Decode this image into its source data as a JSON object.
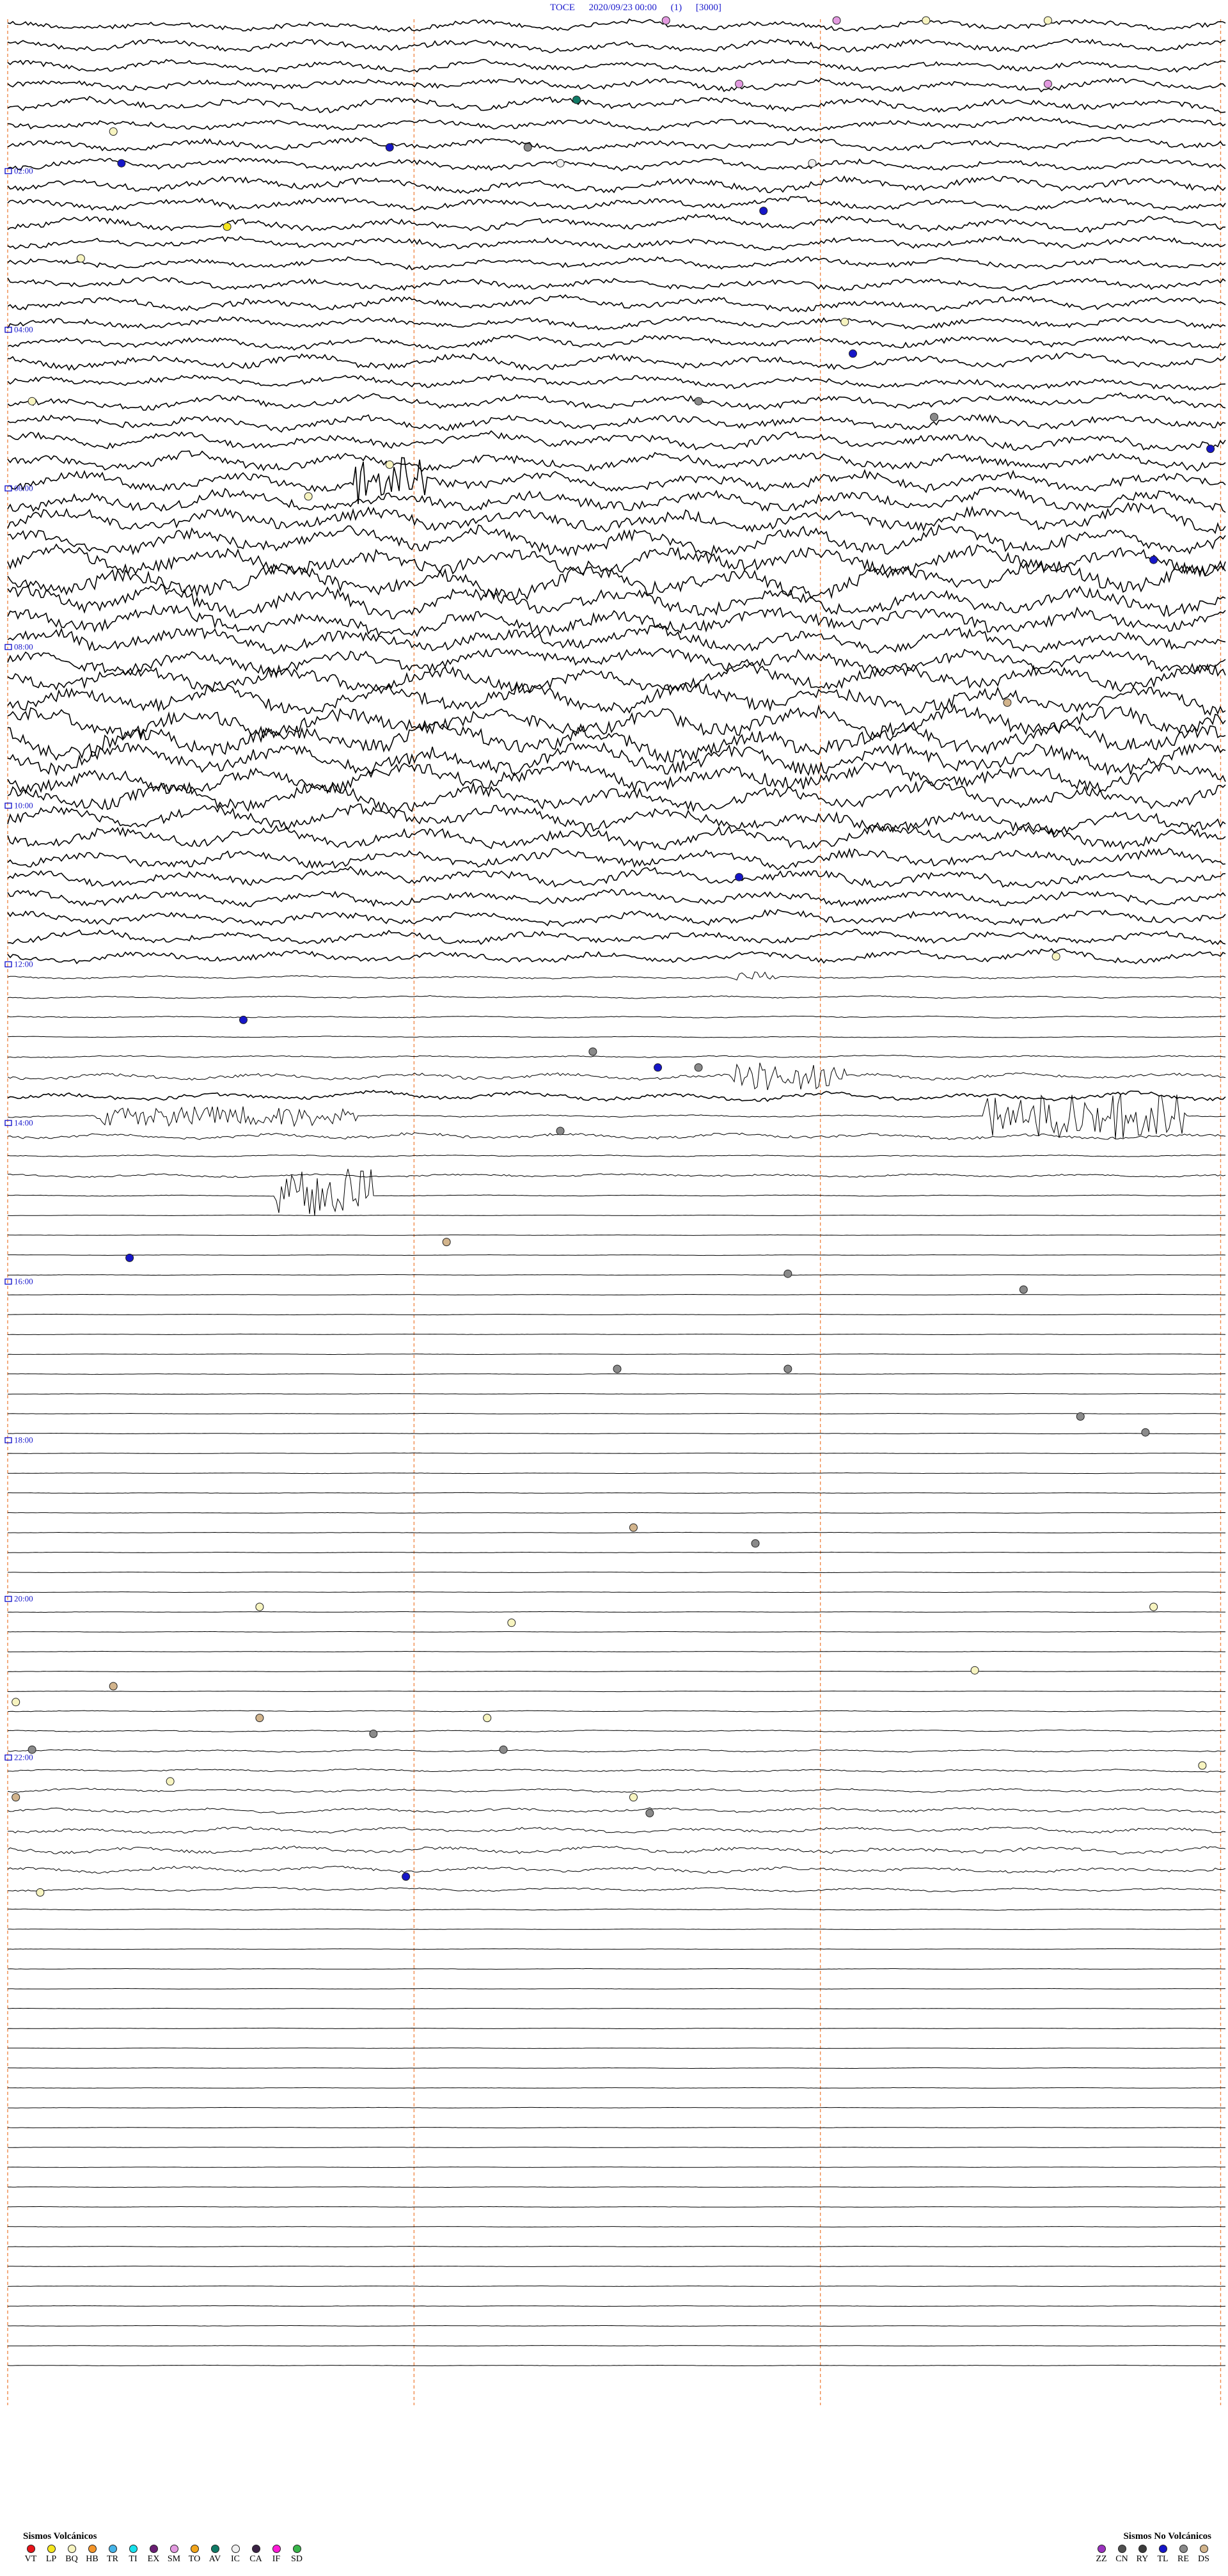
{
  "header": {
    "station": "TOCE",
    "datetime": "2020/09/23 00:00",
    "channel": "(1)",
    "scale": "[3000]"
  },
  "chart_data": {
    "type": "line",
    "title": "TOCE 2020/09/23 00:00 (1) [3000]",
    "hour_labels": [
      "02:00",
      "04:00",
      "06:00",
      "08:00",
      "10:00",
      "12:00",
      "14:00",
      "16:00",
      "18:00",
      "20:00",
      "22:00"
    ],
    "trace_count": 96,
    "minutes_per_trace": 15,
    "traces_recorded": 95,
    "x": {
      "minutes_per_division": 5,
      "divisions": 3
    },
    "amplitude_scale": 3000,
    "grid": true,
    "noise_level": [
      0.9,
      1.0,
      0.9,
      1.0,
      1.1,
      0.9,
      1.0,
      1.0,
      1.2,
      1.0,
      1.1,
      1.0,
      0.9,
      1.0,
      1.1,
      1.0,
      1.0,
      1.2,
      1.0,
      1.1,
      1.3,
      1.4,
      1.5,
      1.6,
      1.8,
      2.0,
      2.2,
      2.4,
      2.6,
      2.4,
      2.2,
      2.0,
      2.0,
      2.2,
      2.4,
      2.6,
      2.8,
      2.6,
      2.4,
      2.2,
      2.0,
      1.8,
      1.6,
      1.5,
      1.3,
      1.2,
      1.1,
      1.0,
      0.25,
      0.2,
      0.15,
      0.1,
      0.2,
      0.6,
      0.7,
      0.2,
      0.5,
      0.15,
      0.3,
      0.1,
      0.05,
      0.05,
      0.05,
      0.05,
      0.05,
      0.05,
      0.05,
      0.05,
      0.05,
      0.05,
      0.05,
      0.05,
      0.05,
      0.05,
      0.05,
      0.05,
      0.05,
      0.05,
      0.05,
      0.05,
      0.05,
      0.05,
      0.05,
      0.05,
      0.05,
      0.1,
      0.15,
      0.2,
      0.25,
      0.3,
      0.4,
      0.5,
      0.6,
      0.5,
      0.3,
      0.1
    ],
    "bursts": [
      {
        "trace": 23,
        "minute": 4.2,
        "duration": 1.0,
        "level": 5
      },
      {
        "trace": 48,
        "minute": 8.9,
        "duration": 0.6,
        "level": 1.2
      },
      {
        "trace": 53,
        "minute": 8.9,
        "duration": 1.4,
        "level": 3.5
      },
      {
        "trace": 55,
        "minute": 1.1,
        "duration": 3.2,
        "level": 2.5
      },
      {
        "trace": 55,
        "minute": 12.0,
        "duration": 2.5,
        "level": 6
      },
      {
        "trace": 59,
        "minute": 3.3,
        "duration": 1.2,
        "level": 7
      }
    ],
    "events": [
      {
        "trace": 0,
        "minute": 8.1,
        "type": "SM"
      },
      {
        "trace": 0,
        "minute": 10.2,
        "type": "SM"
      },
      {
        "trace": 0,
        "minute": 11.3,
        "type": "BQ"
      },
      {
        "trace": 0,
        "minute": 12.8,
        "type": "BQ"
      },
      {
        "trace": 4,
        "minute": 9.0,
        "type": "SM"
      },
      {
        "trace": 4,
        "minute": 12.8,
        "type": "SM"
      },
      {
        "trace": 5,
        "minute": 7.0,
        "type": "AV"
      },
      {
        "trace": 7,
        "minute": 1.3,
        "type": "BQ"
      },
      {
        "trace": 8,
        "minute": 4.7,
        "type": "TL"
      },
      {
        "trace": 8,
        "minute": 6.4,
        "type": "RE"
      },
      {
        "trace": 9,
        "minute": 1.4,
        "type": "TL"
      },
      {
        "trace": 9,
        "minute": 6.8,
        "type": "IC"
      },
      {
        "trace": 9,
        "minute": 9.9,
        "type": "IC"
      },
      {
        "trace": 12,
        "minute": 9.3,
        "type": "TL"
      },
      {
        "trace": 13,
        "minute": 2.7,
        "type": "LP"
      },
      {
        "trace": 15,
        "minute": 0.9,
        "type": "BQ"
      },
      {
        "trace": 19,
        "minute": 10.3,
        "type": "BQ"
      },
      {
        "trace": 21,
        "minute": 10.4,
        "type": "TL"
      },
      {
        "trace": 24,
        "minute": 0.3,
        "type": "BQ"
      },
      {
        "trace": 24,
        "minute": 8.5,
        "type": "RE"
      },
      {
        "trace": 25,
        "minute": 11.4,
        "type": "RE"
      },
      {
        "trace": 27,
        "minute": 14.8,
        "type": "TL"
      },
      {
        "trace": 28,
        "minute": 4.7,
        "type": "BQ"
      },
      {
        "trace": 30,
        "minute": 3.7,
        "type": "BQ"
      },
      {
        "trace": 34,
        "minute": 14.1,
        "type": "TL"
      },
      {
        "trace": 43,
        "minute": 12.3,
        "type": "DS"
      },
      {
        "trace": 54,
        "minute": 9.0,
        "type": "TL"
      },
      {
        "trace": 59,
        "minute": 12.9,
        "type": "BQ"
      },
      {
        "trace": 63,
        "minute": 2.9,
        "type": "TL"
      },
      {
        "trace": 65,
        "minute": 7.2,
        "type": "RE"
      },
      {
        "trace": 66,
        "minute": 8.0,
        "type": "TL"
      },
      {
        "trace": 66,
        "minute": 8.5,
        "type": "RE"
      },
      {
        "trace": 70,
        "minute": 6.8,
        "type": "RE"
      },
      {
        "trace": 77,
        "minute": 5.4,
        "type": "DS"
      },
      {
        "trace": 78,
        "minute": 1.5,
        "type": "TL"
      },
      {
        "trace": 79,
        "minute": 9.6,
        "type": "RE"
      },
      {
        "trace": 80,
        "minute": 12.5,
        "type": "RE"
      },
      {
        "trace": 85,
        "minute": 7.5,
        "type": "RE"
      },
      {
        "trace": 85,
        "minute": 9.6,
        "type": "RE"
      },
      {
        "trace": 88,
        "minute": 13.2,
        "type": "RE"
      },
      {
        "trace": 89,
        "minute": 14.0,
        "type": "RE"
      },
      {
        "trace": 95,
        "minute": 7.7,
        "type": "DS"
      },
      {
        "trace": 96,
        "minute": 9.2,
        "type": "RE"
      },
      {
        "trace": 100,
        "minute": 3.1,
        "type": "BQ"
      },
      {
        "trace": 100,
        "minute": 14.1,
        "type": "BQ"
      },
      {
        "trace": 101,
        "minute": 6.2,
        "type": "BQ"
      },
      {
        "trace": 104,
        "minute": 11.9,
        "type": "BQ"
      },
      {
        "trace": 105,
        "minute": 1.3,
        "type": "DS"
      },
      {
        "trace": 106,
        "minute": 0.1,
        "type": "BQ"
      },
      {
        "trace": 107,
        "minute": 3.1,
        "type": "DS"
      },
      {
        "trace": 107,
        "minute": 5.9,
        "type": "BQ"
      },
      {
        "trace": 108,
        "minute": 4.5,
        "type": "RE"
      },
      {
        "trace": 109,
        "minute": 6.1,
        "type": "RE"
      },
      {
        "trace": 109,
        "minute": 0.3,
        "type": "RE"
      },
      {
        "trace": 110,
        "minute": 14.7,
        "type": "BQ"
      },
      {
        "trace": 111,
        "minute": 2.0,
        "type": "BQ"
      },
      {
        "trace": 112,
        "minute": 0.1,
        "type": "DS"
      },
      {
        "trace": 112,
        "minute": 7.7,
        "type": "BQ"
      },
      {
        "trace": 113,
        "minute": 7.9,
        "type": "RE"
      },
      {
        "trace": 117,
        "minute": 4.9,
        "type": "TL"
      },
      {
        "trace": 118,
        "minute": 0.4,
        "type": "BQ"
      }
    ]
  },
  "event_colors": {
    "VT": "#e8141a",
    "LP": "#f5e620",
    "BQ": "#f7f4c0",
    "HB": "#f4952a",
    "TR": "#46b4e8",
    "TI": "#18e1ec",
    "EX": "#6b1f74",
    "SM": "#e39ae0",
    "TO": "#f2a51c",
    "AV": "#0f7a66",
    "IC": "#f0f0f0",
    "CA": "#3b2345",
    "IF": "#ff1ad7",
    "SD": "#39b54a",
    "ZZ": "#9b32bf",
    "CN": "#505050",
    "RY": "#3c3c3c",
    "TL": "#1616c8",
    "RE": "#8a8a8a",
    "DS": "#d2b48c"
  },
  "legend": {
    "volcanic": {
      "title": "Sismos Volcánicos",
      "items": [
        {
          "code": "VT",
          "color": "#e8141a"
        },
        {
          "code": "LP",
          "color": "#f5e620"
        },
        {
          "code": "BQ",
          "color": "#f7f4c0"
        },
        {
          "code": "HB",
          "color": "#f4952a"
        },
        {
          "code": "TR",
          "color": "#46b4e8"
        },
        {
          "code": "TI",
          "color": "#18e1ec"
        },
        {
          "code": "EX",
          "color": "#6b1f74"
        },
        {
          "code": "SM",
          "color": "#e39ae0"
        },
        {
          "code": "TO",
          "color": "#f2a51c"
        },
        {
          "code": "AV",
          "color": "#0f7a66"
        },
        {
          "code": "IC",
          "color": "#f0f0f0"
        },
        {
          "code": "CA",
          "color": "#3b2345"
        },
        {
          "code": "IF",
          "color": "#ff1ad7"
        },
        {
          "code": "SD",
          "color": "#39b54a"
        }
      ]
    },
    "non_volcanic": {
      "title": "Sismos No Volcánicos",
      "items": [
        {
          "code": "ZZ",
          "color": "#9b32bf"
        },
        {
          "code": "CN",
          "color": "#505050"
        },
        {
          "code": "RY",
          "color": "#3c3c3c"
        },
        {
          "code": "TL",
          "color": "#1616c8"
        },
        {
          "code": "RE",
          "color": "#8a8a8a"
        },
        {
          "code": "DS",
          "color": "#d2b48c"
        }
      ]
    }
  },
  "colors": {
    "trace": "#000000",
    "minute_grid": "#f08a4b",
    "hour_marker": "#1a1acc",
    "header_text": "#1a1acc"
  }
}
